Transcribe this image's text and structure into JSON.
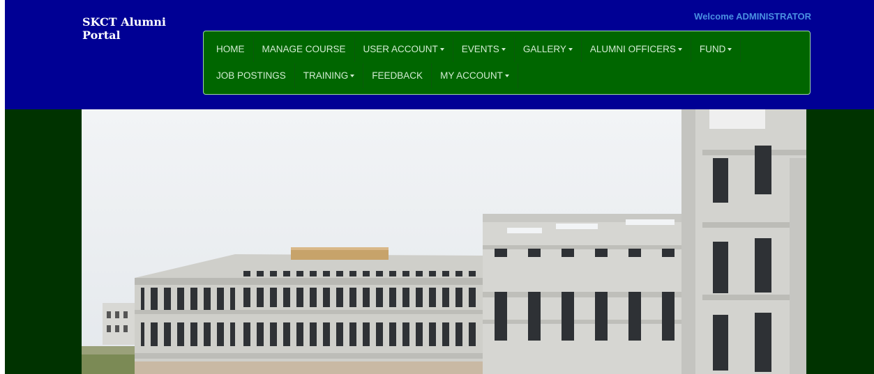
{
  "brand": {
    "line1": "SKCT Alumni",
    "line2": "Portal"
  },
  "welcome": "Welcome ADMINISTRATOR",
  "nav": {
    "row1": [
      {
        "label": "HOME",
        "dropdown": false
      },
      {
        "label": "MANAGE COURSE",
        "dropdown": false
      },
      {
        "label": "USER ACCOUNT",
        "dropdown": true
      },
      {
        "label": "EVENTS",
        "dropdown": true
      },
      {
        "label": "GALLERY",
        "dropdown": true
      },
      {
        "label": "ALUMNI OFFICERS",
        "dropdown": true
      },
      {
        "label": "FUND",
        "dropdown": true
      }
    ],
    "row2": [
      {
        "label": "JOB POSTINGS",
        "dropdown": false
      },
      {
        "label": "TRAINING",
        "dropdown": true
      },
      {
        "label": "FEEDBACK",
        "dropdown": false
      },
      {
        "label": "MY ACCOUNT",
        "dropdown": true
      }
    ]
  },
  "colors": {
    "header_bg": "#000094",
    "nav_bg": "#006600",
    "hero_bg": "#003300",
    "welcome_text": "#4a90e2"
  }
}
